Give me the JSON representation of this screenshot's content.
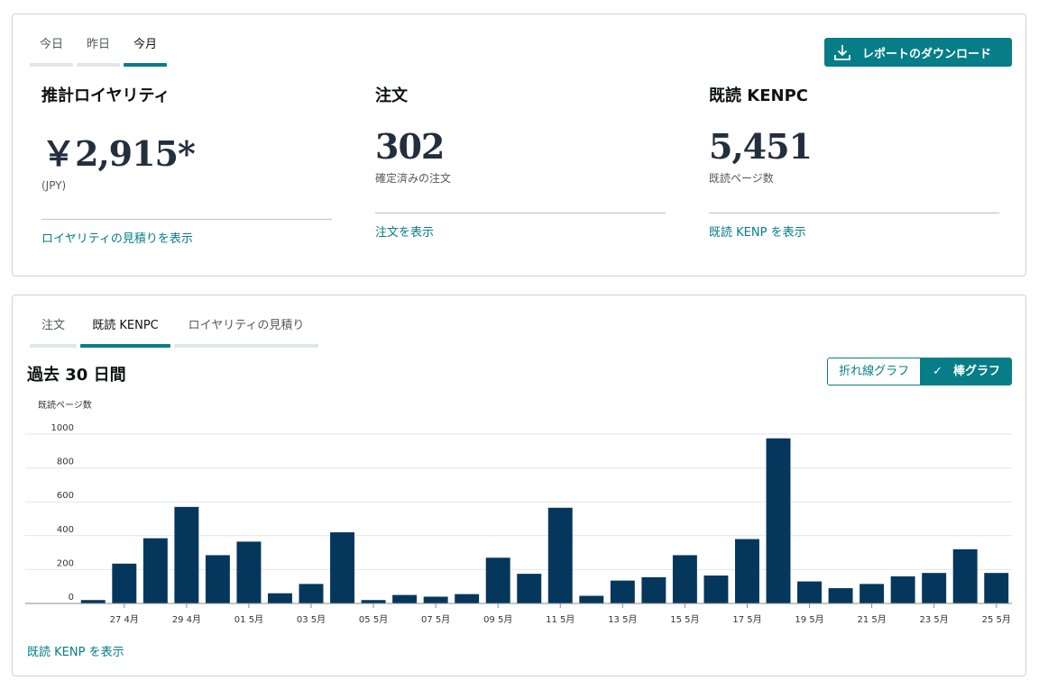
{
  "summary": {
    "tabs": [
      "今日",
      "昨日",
      "今月"
    ],
    "active_tab": 2,
    "download_label": "レポートのダウンロード",
    "metrics": [
      {
        "title": "推計ロイヤリティ",
        "value": "￥2,915*",
        "sub": "(JPY)",
        "link": "ロイヤリティの見積りを表示"
      },
      {
        "title": "注文",
        "value": "302",
        "sub": "確定済みの注文",
        "link": "注文を表示"
      },
      {
        "title": "既読 KENPC",
        "value": "5,451",
        "sub": "既読ページ数",
        "link": "既読 KENP を表示"
      }
    ]
  },
  "chart_panel": {
    "tabs": [
      "注文",
      "既読 KENPC",
      "ロイヤリティの見積り"
    ],
    "active_tab": 1,
    "title": "過去 30 日間",
    "toggle": {
      "line_label": "折れ線グラフ",
      "bar_label": "棒グラフ",
      "check": "✓"
    },
    "link": "既読 KENP を表示"
  },
  "chart_data": {
    "type": "bar",
    "ylabel": "既読ページ数",
    "xlabel": "",
    "ylim": [
      0,
      1000
    ],
    "yticks": [
      0,
      200,
      400,
      600,
      800,
      1000
    ],
    "grid": true,
    "bar_color": "#05375c",
    "categories": [
      "26 4月",
      "27 4月",
      "28 4月",
      "29 4月",
      "30 4月",
      "01 5月",
      "02 5月",
      "03 5月",
      "04 5月",
      "05 5月",
      "06 5月",
      "07 5月",
      "08 5月",
      "09 5月",
      "10 5月",
      "11 5月",
      "12 5月",
      "13 5月",
      "14 5月",
      "15 5月",
      "16 5月",
      "17 5月",
      "18 5月",
      "19 5月",
      "20 5月",
      "21 5月",
      "22 5月",
      "23 5月",
      "24 5月",
      "25 5月"
    ],
    "tick_labels": [
      "27 4月",
      "29 4月",
      "01 5月",
      "03 5月",
      "05 5月",
      "07 5月",
      "09 5月",
      "11 5月",
      "13 5月",
      "15 5月",
      "17 5月",
      "19 5月",
      "21 5月",
      "23 5月",
      "25 5月"
    ],
    "values": [
      20,
      235,
      385,
      570,
      285,
      365,
      60,
      115,
      420,
      20,
      50,
      40,
      55,
      270,
      175,
      565,
      45,
      135,
      155,
      285,
      165,
      380,
      975,
      130,
      90,
      115,
      160,
      180,
      320,
      180
    ]
  },
  "colors": {
    "accent": "#067d87",
    "bar": "#05375c"
  }
}
